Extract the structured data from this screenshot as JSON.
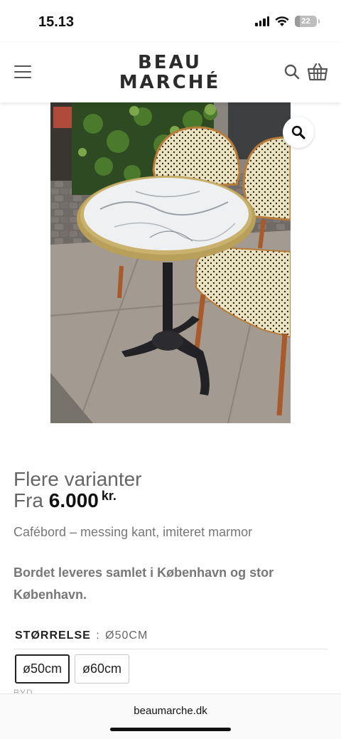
{
  "status_bar": {
    "time": "15.13",
    "battery_level": "22",
    "battery_fraction": 0.22
  },
  "header": {
    "logo_line1": "BEAU",
    "logo_line2": "MARCHÉ",
    "icons": [
      "menu-icon",
      "search-icon",
      "cart-icon"
    ]
  },
  "product": {
    "image_icon": "zoom-icon",
    "variants_heading": "Flere varianter",
    "price_prefix": "Fra",
    "price_value": "6.000",
    "price_currency": "kr.",
    "subtitle": "Cafébord – messing kant, imiteret marmor",
    "description": "Bordet leveres samlet i København og stor København.",
    "size_label": "STØRRELSE",
    "size_separator": ":",
    "size_selected_value": "Ø50CM",
    "size_options": [
      {
        "label": "ø50cm",
        "selected": true
      },
      {
        "label": "ø60cm",
        "selected": false
      }
    ],
    "clipped_label": "BYD"
  },
  "browser": {
    "url": "beaumarche.dk"
  },
  "colors": {
    "text_dark": "#222222",
    "text_muted": "#666666",
    "brass": "#b8a05a",
    "marble": "#eef0f1"
  }
}
